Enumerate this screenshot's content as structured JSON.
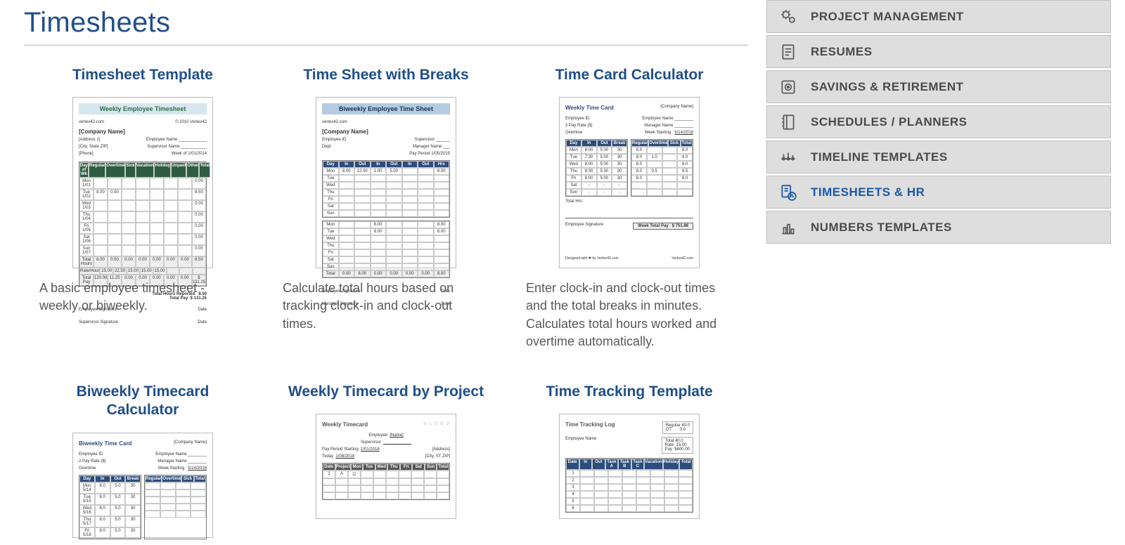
{
  "section_title": "Timesheets",
  "cards": [
    {
      "title": "Timesheet Template",
      "thumb_title": "Weekly Employee Timesheet",
      "desc": "A basic employee timesheet - weekly or biweekly."
    },
    {
      "title": "Time Sheet with Breaks",
      "thumb_title": "Biweekly Employee Time Sheet",
      "desc": "Calculate total hours based on tracking clock-in and clock-out times."
    },
    {
      "title": "Time Card Calculator",
      "thumb_title": "Weekly Time Card",
      "desc": "Enter clock-in and clock-out times and the total breaks in minutes. Calculates total hours worked and overtime automatically."
    },
    {
      "title": "Biweekly Timecard Calculator",
      "thumb_title": "Biweekly Time Card",
      "desc": ""
    },
    {
      "title": "Weekly Timecard by Project",
      "thumb_title": "Weekly Timecard",
      "desc": ""
    },
    {
      "title": "Time Tracking Template",
      "thumb_title": "Time Tracking Log",
      "desc": ""
    }
  ],
  "thumb_company_label": "[Company Name]",
  "sidebar": [
    {
      "label": "PROJECT MANAGEMENT",
      "icon": "gears-icon",
      "active": false
    },
    {
      "label": "RESUMES",
      "icon": "document-icon",
      "active": false
    },
    {
      "label": "SAVINGS & RETIREMENT",
      "icon": "safe-icon",
      "active": false
    },
    {
      "label": "SCHEDULES / PLANNERS",
      "icon": "notebook-icon",
      "active": false
    },
    {
      "label": "TIMELINE TEMPLATES",
      "icon": "timeline-icon",
      "active": false
    },
    {
      "label": "TIMESHEETS & HR",
      "icon": "timesheet-icon",
      "active": true
    },
    {
      "label": "NUMBERS TEMPLATES",
      "icon": "chart-icon",
      "active": false
    }
  ]
}
